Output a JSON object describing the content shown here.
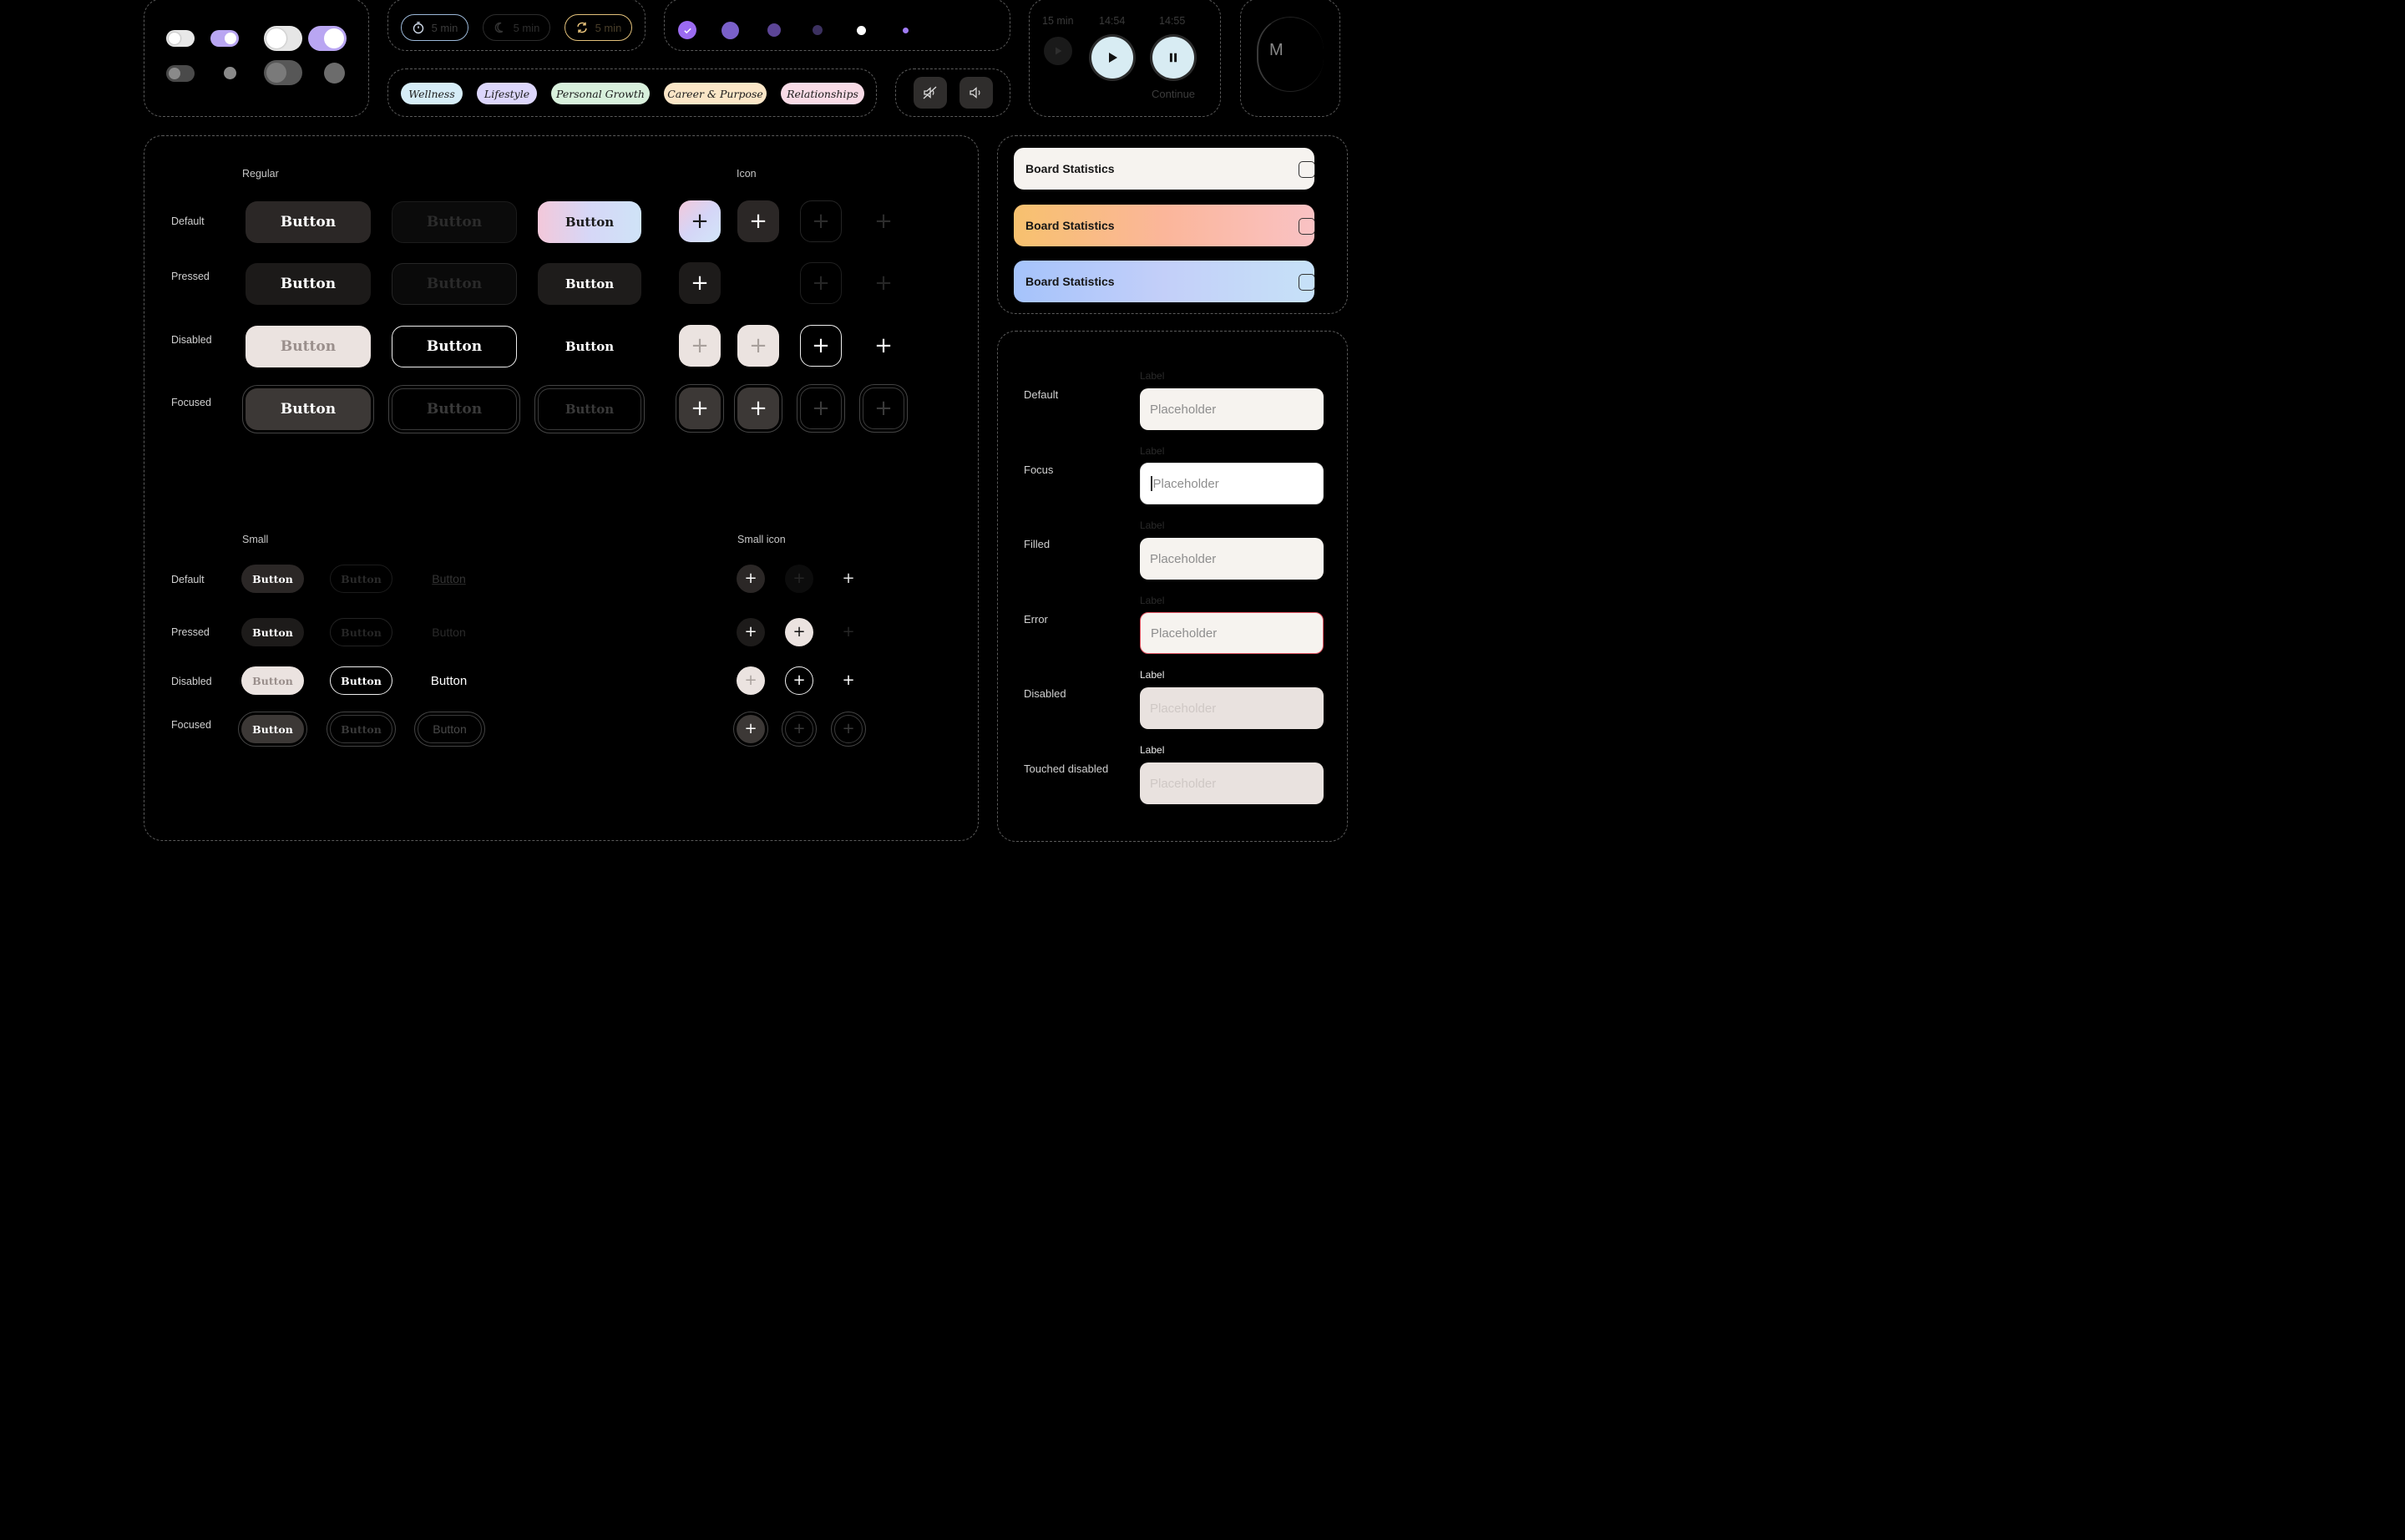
{
  "colors": {
    "background": "#000000",
    "purple": "#a78bfa",
    "dark_button": "#2b2726",
    "light_button": "#ebe3e0",
    "error_border": "#e25563"
  },
  "timers": [
    {
      "icon": "stopwatch-icon",
      "label": "5 min"
    },
    {
      "icon": "moon-icon",
      "label": "5 min"
    },
    {
      "icon": "repeat-icon",
      "label": "5 min"
    }
  ],
  "tags": [
    "Wellness",
    "Lifestyle",
    "Personal Growth",
    "Career & Purpose",
    "Relationships"
  ],
  "player": {
    "time_labels": [
      "15 min",
      "14:54",
      "14:55"
    ],
    "continue_label": "Continue"
  },
  "avatar_letter": "M",
  "buttons": {
    "regular_header": "Regular",
    "icon_header": "Icon",
    "small_header": "Small",
    "small_icon_header": "Small icon",
    "states": [
      "Default",
      "Pressed",
      "Disabled",
      "Focused"
    ],
    "label": "Button",
    "plus": "+"
  },
  "board_statistics": [
    {
      "title": "Board Statistics"
    },
    {
      "title": "Board Statistics"
    },
    {
      "title": "Board Statistics"
    }
  ],
  "inputs": [
    {
      "state": "Default",
      "label": "Label",
      "placeholder": "Placeholder"
    },
    {
      "state": "Focus",
      "label": "Label",
      "placeholder": "Placeholder"
    },
    {
      "state": "Filled",
      "label": "Label",
      "placeholder": "Placeholder"
    },
    {
      "state": "Error",
      "label": "Label",
      "placeholder": "Placeholder"
    },
    {
      "state": "Disabled",
      "label": "Label",
      "placeholder": "Placeholder"
    },
    {
      "state": "Touched disabled",
      "label": "Label",
      "placeholder": "Placeholder"
    }
  ]
}
